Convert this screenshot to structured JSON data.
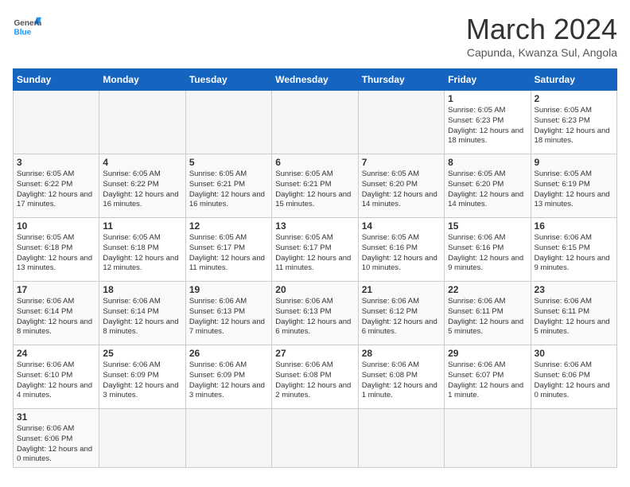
{
  "header": {
    "logo_general": "General",
    "logo_blue": "Blue",
    "month_title": "March 2024",
    "subtitle": "Capunda, Kwanza Sul, Angola"
  },
  "days_of_week": [
    "Sunday",
    "Monday",
    "Tuesday",
    "Wednesday",
    "Thursday",
    "Friday",
    "Saturday"
  ],
  "weeks": [
    [
      {
        "day": "",
        "info": ""
      },
      {
        "day": "",
        "info": ""
      },
      {
        "day": "",
        "info": ""
      },
      {
        "day": "",
        "info": ""
      },
      {
        "day": "",
        "info": ""
      },
      {
        "day": "1",
        "info": "Sunrise: 6:05 AM\nSunset: 6:23 PM\nDaylight: 12 hours and 18 minutes."
      },
      {
        "day": "2",
        "info": "Sunrise: 6:05 AM\nSunset: 6:23 PM\nDaylight: 12 hours and 18 minutes."
      }
    ],
    [
      {
        "day": "3",
        "info": "Sunrise: 6:05 AM\nSunset: 6:22 PM\nDaylight: 12 hours and 17 minutes."
      },
      {
        "day": "4",
        "info": "Sunrise: 6:05 AM\nSunset: 6:22 PM\nDaylight: 12 hours and 16 minutes."
      },
      {
        "day": "5",
        "info": "Sunrise: 6:05 AM\nSunset: 6:21 PM\nDaylight: 12 hours and 16 minutes."
      },
      {
        "day": "6",
        "info": "Sunrise: 6:05 AM\nSunset: 6:21 PM\nDaylight: 12 hours and 15 minutes."
      },
      {
        "day": "7",
        "info": "Sunrise: 6:05 AM\nSunset: 6:20 PM\nDaylight: 12 hours and 14 minutes."
      },
      {
        "day": "8",
        "info": "Sunrise: 6:05 AM\nSunset: 6:20 PM\nDaylight: 12 hours and 14 minutes."
      },
      {
        "day": "9",
        "info": "Sunrise: 6:05 AM\nSunset: 6:19 PM\nDaylight: 12 hours and 13 minutes."
      }
    ],
    [
      {
        "day": "10",
        "info": "Sunrise: 6:05 AM\nSunset: 6:18 PM\nDaylight: 12 hours and 13 minutes."
      },
      {
        "day": "11",
        "info": "Sunrise: 6:05 AM\nSunset: 6:18 PM\nDaylight: 12 hours and 12 minutes."
      },
      {
        "day": "12",
        "info": "Sunrise: 6:05 AM\nSunset: 6:17 PM\nDaylight: 12 hours and 11 minutes."
      },
      {
        "day": "13",
        "info": "Sunrise: 6:05 AM\nSunset: 6:17 PM\nDaylight: 12 hours and 11 minutes."
      },
      {
        "day": "14",
        "info": "Sunrise: 6:05 AM\nSunset: 6:16 PM\nDaylight: 12 hours and 10 minutes."
      },
      {
        "day": "15",
        "info": "Sunrise: 6:06 AM\nSunset: 6:16 PM\nDaylight: 12 hours and 9 minutes."
      },
      {
        "day": "16",
        "info": "Sunrise: 6:06 AM\nSunset: 6:15 PM\nDaylight: 12 hours and 9 minutes."
      }
    ],
    [
      {
        "day": "17",
        "info": "Sunrise: 6:06 AM\nSunset: 6:14 PM\nDaylight: 12 hours and 8 minutes."
      },
      {
        "day": "18",
        "info": "Sunrise: 6:06 AM\nSunset: 6:14 PM\nDaylight: 12 hours and 8 minutes."
      },
      {
        "day": "19",
        "info": "Sunrise: 6:06 AM\nSunset: 6:13 PM\nDaylight: 12 hours and 7 minutes."
      },
      {
        "day": "20",
        "info": "Sunrise: 6:06 AM\nSunset: 6:13 PM\nDaylight: 12 hours and 6 minutes."
      },
      {
        "day": "21",
        "info": "Sunrise: 6:06 AM\nSunset: 6:12 PM\nDaylight: 12 hours and 6 minutes."
      },
      {
        "day": "22",
        "info": "Sunrise: 6:06 AM\nSunset: 6:11 PM\nDaylight: 12 hours and 5 minutes."
      },
      {
        "day": "23",
        "info": "Sunrise: 6:06 AM\nSunset: 6:11 PM\nDaylight: 12 hours and 5 minutes."
      }
    ],
    [
      {
        "day": "24",
        "info": "Sunrise: 6:06 AM\nSunset: 6:10 PM\nDaylight: 12 hours and 4 minutes."
      },
      {
        "day": "25",
        "info": "Sunrise: 6:06 AM\nSunset: 6:09 PM\nDaylight: 12 hours and 3 minutes."
      },
      {
        "day": "26",
        "info": "Sunrise: 6:06 AM\nSunset: 6:09 PM\nDaylight: 12 hours and 3 minutes."
      },
      {
        "day": "27",
        "info": "Sunrise: 6:06 AM\nSunset: 6:08 PM\nDaylight: 12 hours and 2 minutes."
      },
      {
        "day": "28",
        "info": "Sunrise: 6:06 AM\nSunset: 6:08 PM\nDaylight: 12 hours and 1 minute."
      },
      {
        "day": "29",
        "info": "Sunrise: 6:06 AM\nSunset: 6:07 PM\nDaylight: 12 hours and 1 minute."
      },
      {
        "day": "30",
        "info": "Sunrise: 6:06 AM\nSunset: 6:06 PM\nDaylight: 12 hours and 0 minutes."
      }
    ],
    [
      {
        "day": "31",
        "info": "Sunrise: 6:06 AM\nSunset: 6:06 PM\nDaylight: 12 hours and 0 minutes."
      },
      {
        "day": "",
        "info": ""
      },
      {
        "day": "",
        "info": ""
      },
      {
        "day": "",
        "info": ""
      },
      {
        "day": "",
        "info": ""
      },
      {
        "day": "",
        "info": ""
      },
      {
        "day": "",
        "info": ""
      }
    ]
  ]
}
